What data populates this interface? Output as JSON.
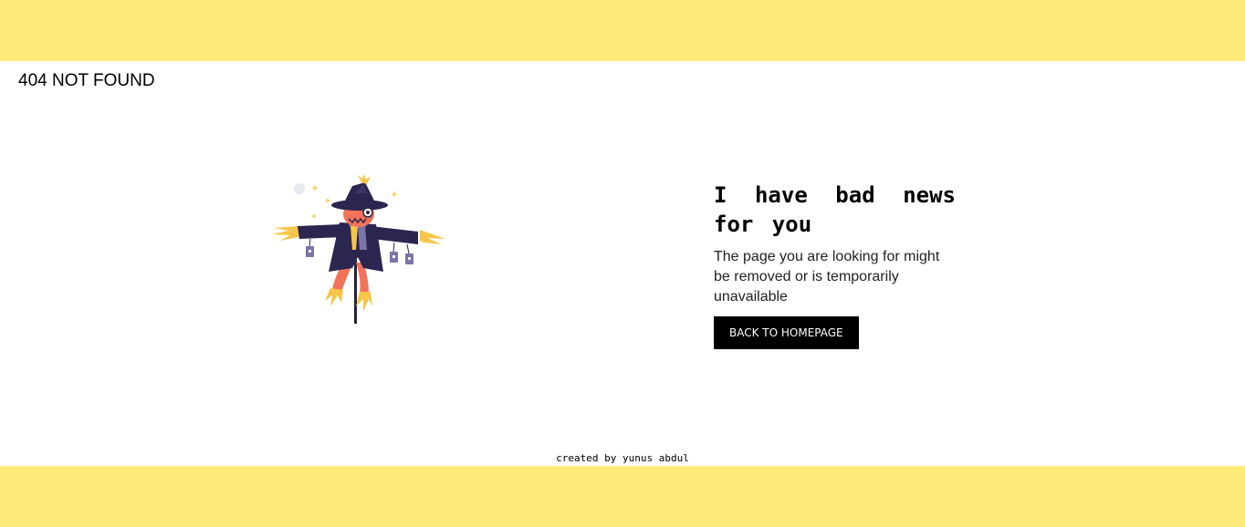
{
  "colors": {
    "band": "#FFE97A",
    "button_bg": "#000000",
    "button_text": "#FFFFFF"
  },
  "header": {
    "title": "404 NOT FOUND"
  },
  "illustration": {
    "icon": "scarecrow-illustration"
  },
  "message": {
    "headline": "I have bad news for you",
    "description": "The page you are looking for might be removed or is temporarily unavailable",
    "button_label": "BACK TO HOMEPAGE"
  },
  "footer": {
    "credit": "created by yunus abdul"
  }
}
